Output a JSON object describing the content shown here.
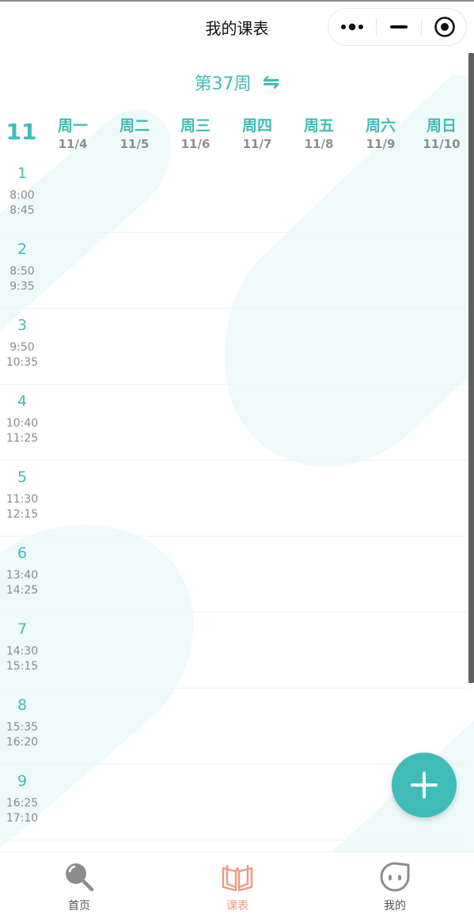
{
  "titlebar": {
    "title": "我的课表",
    "more_icon": "more-dots-icon",
    "minimize_icon": "minimize-icon",
    "close_icon": "target-close-icon"
  },
  "week": {
    "label": "第37周",
    "switch_icon": "swap-arrows-icon"
  },
  "month": "11",
  "days": [
    {
      "name": "周一",
      "date": "11/4"
    },
    {
      "name": "周二",
      "date": "11/5"
    },
    {
      "name": "周三",
      "date": "11/6"
    },
    {
      "name": "周四",
      "date": "11/7"
    },
    {
      "name": "周五",
      "date": "11/8"
    },
    {
      "name": "周六",
      "date": "11/9"
    },
    {
      "name": "周日",
      "date": "11/10"
    }
  ],
  "periods": [
    {
      "num": "1",
      "start": "8:00",
      "end": "8:45"
    },
    {
      "num": "2",
      "start": "8:50",
      "end": "9:35"
    },
    {
      "num": "3",
      "start": "9:50",
      "end": "10:35"
    },
    {
      "num": "4",
      "start": "10:40",
      "end": "11:25"
    },
    {
      "num": "5",
      "start": "11:30",
      "end": "12:15"
    },
    {
      "num": "6",
      "start": "13:40",
      "end": "14:25"
    },
    {
      "num": "7",
      "start": "14:30",
      "end": "15:15"
    },
    {
      "num": "8",
      "start": "15:35",
      "end": "16:20"
    },
    {
      "num": "9",
      "start": "16:25",
      "end": "17:10"
    }
  ],
  "fab": {
    "icon": "plus-icon"
  },
  "tabbar": {
    "items": [
      {
        "label": "首页",
        "icon": "search-icon",
        "active": false
      },
      {
        "label": "课表",
        "icon": "book-icon",
        "active": true
      },
      {
        "label": "我的",
        "icon": "face-icon",
        "active": false
      }
    ]
  },
  "colors": {
    "accent": "#3fbcb8",
    "active_tab": "#ef9a7e",
    "muted": "#8a8a8a",
    "decor": "#eefafa"
  }
}
